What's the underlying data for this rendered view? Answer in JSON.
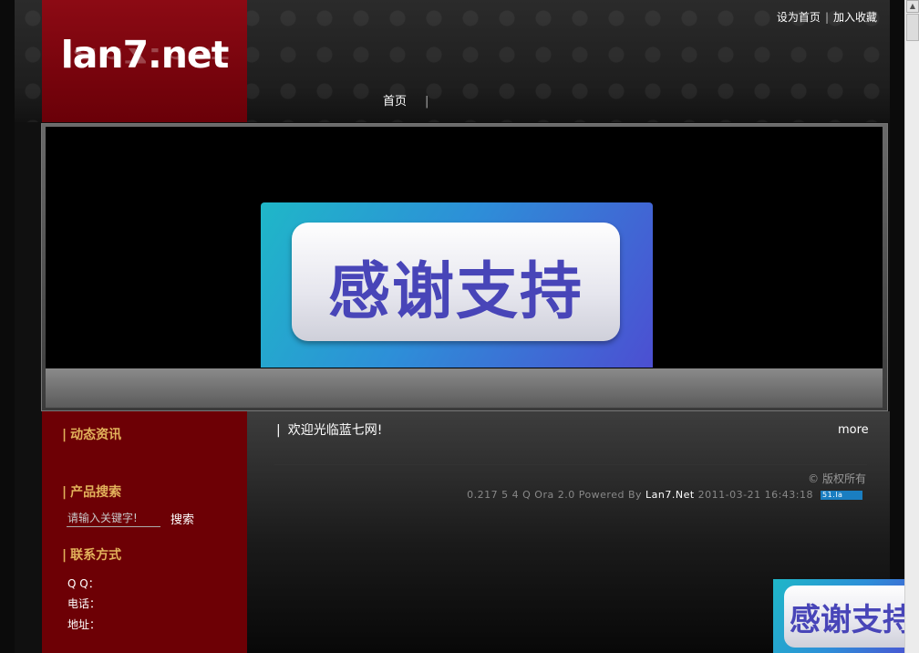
{
  "header": {
    "logo": "lan7.net",
    "top_links": {
      "home": "设为首页",
      "separator": "|",
      "favorite": "加入收藏"
    },
    "nav": {
      "home": "首页",
      "separator": "|"
    }
  },
  "banner": {
    "image_text": "感谢支持"
  },
  "sidebar": {
    "news_title": "动态资讯",
    "search_title": "产品搜索",
    "search_placeholder": "请输入关键字!",
    "search_button": "搜索",
    "contact_title": "联系方式",
    "qq_label": "Q  Q：",
    "phone_label": "电话：",
    "address_label": "地址：",
    "title_bar": "|"
  },
  "main": {
    "welcome_bar": "|",
    "welcome_text": "欢迎光临蓝七网!",
    "more": "more",
    "copyright": "© 版权所有",
    "powered_prefix": "0.217 5 4 Q Ora 2.0 Powered By",
    "powered_brand": "Lan7.Net",
    "powered_time": "2011-03-21 16:43:18",
    "stat_badge": "51.la"
  },
  "float_ad": {
    "text": "感谢支持"
  },
  "colors": {
    "sidebar_bg": "#6d0005",
    "side_title": "#e2b25b",
    "logo_bg": "#8c0a14"
  },
  "icons": {
    "scroll_up": "scroll-up-arrow-icon"
  }
}
